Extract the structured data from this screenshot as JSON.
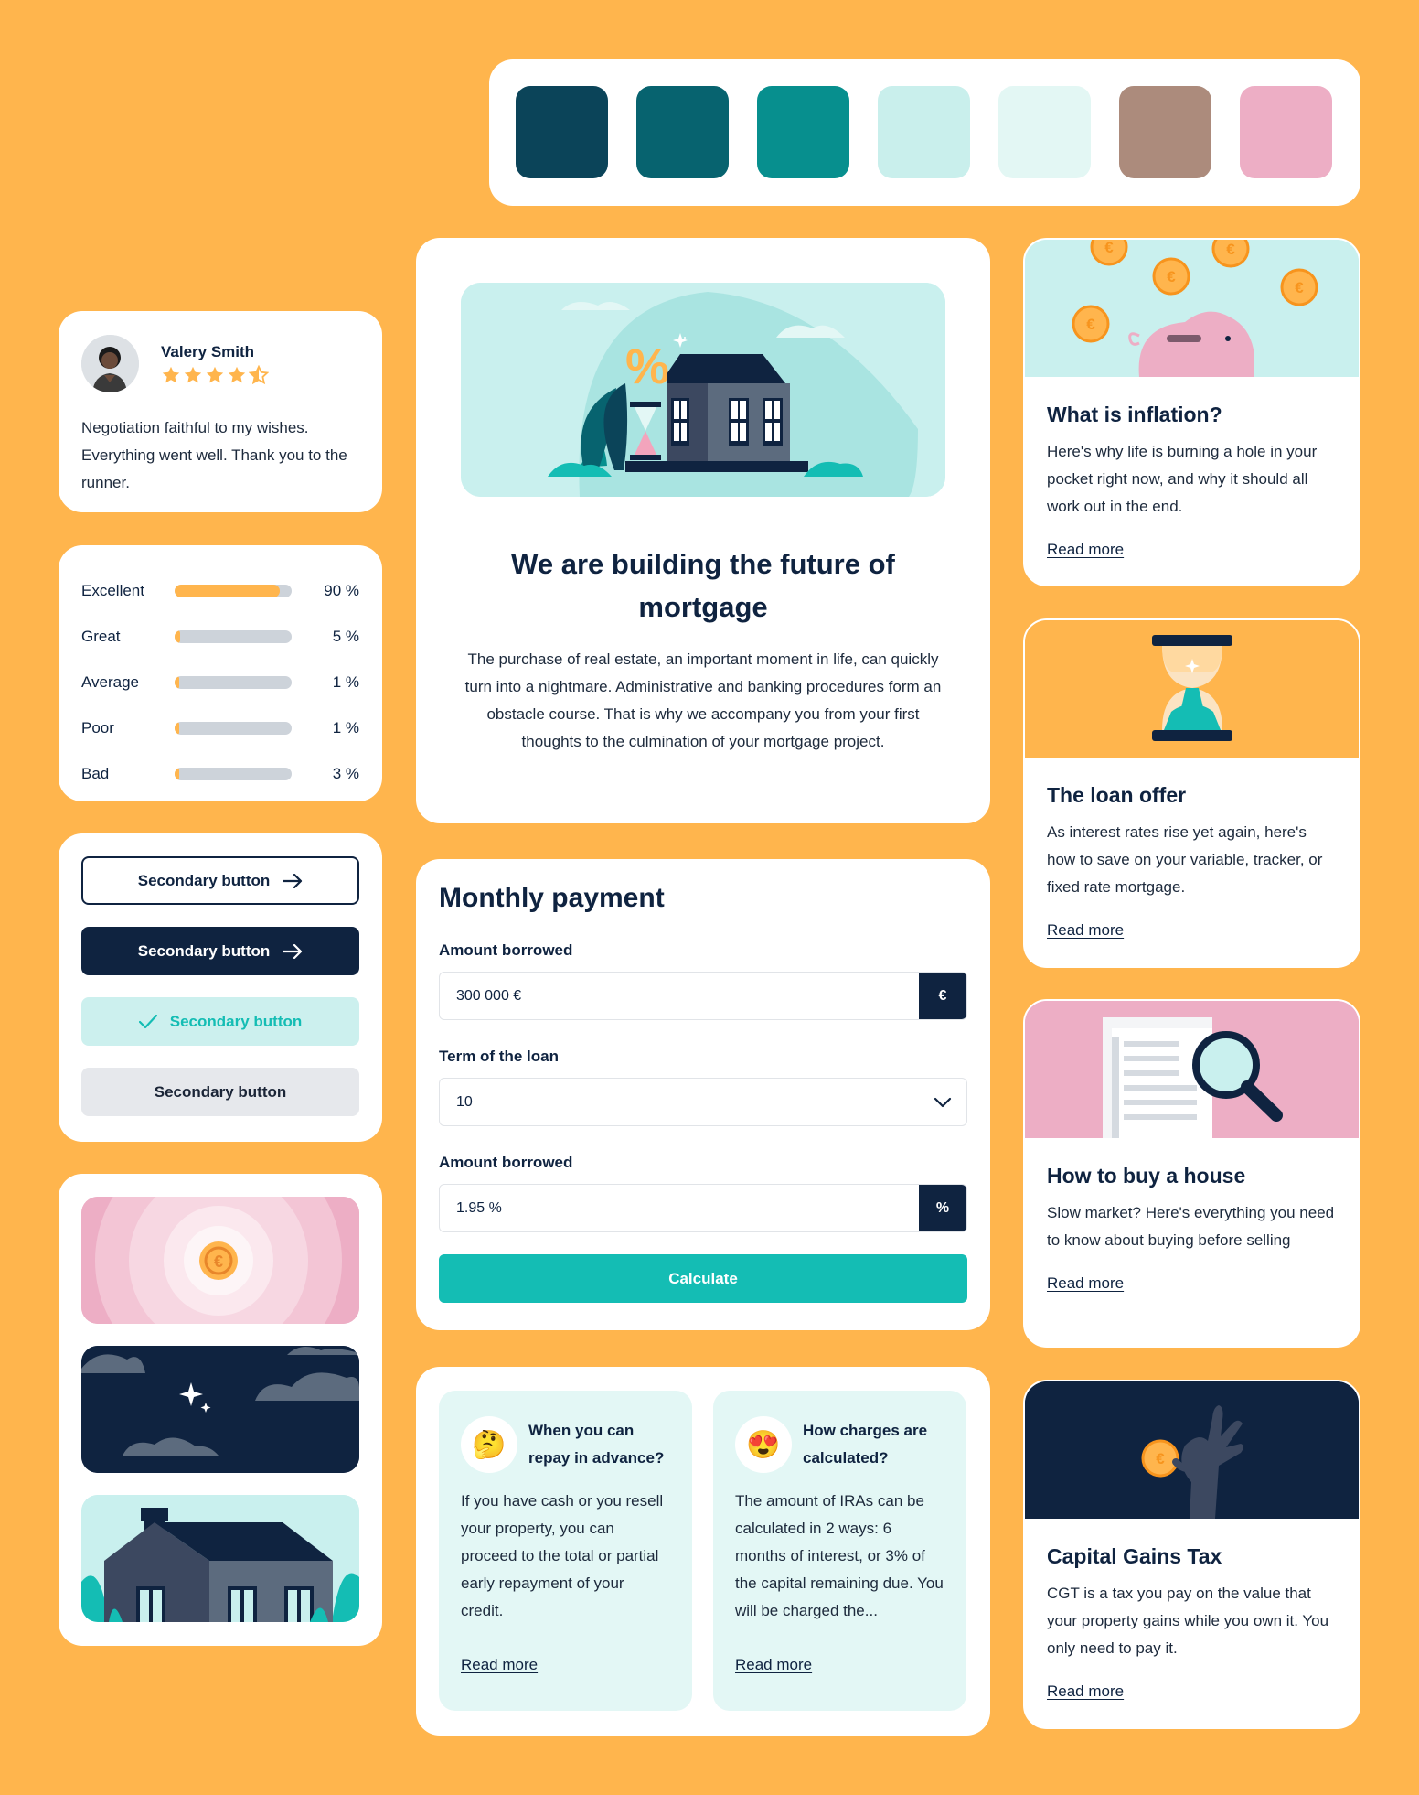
{
  "colors": {
    "palette": [
      "#0B4459",
      "#07636F",
      "#078F8E",
      "#C9EFEC",
      "#E3F7F4",
      "#AC8B7C",
      "#EDAEC5"
    ],
    "background": "#FFB54D",
    "navy": "#0F2340",
    "teal": "#14BDB4"
  },
  "review": {
    "name": "Valery Smith",
    "rating": 4.5,
    "text": "Negotiation faithful to my wishes. Everything went well. Thank you to the runner."
  },
  "ratings": [
    {
      "label": "Excellent",
      "value": 90,
      "pct": "90 %"
    },
    {
      "label": "Great",
      "value": 5,
      "pct": "5 %"
    },
    {
      "label": "Average",
      "value": 1,
      "pct": "1 %"
    },
    {
      "label": "Poor",
      "value": 1,
      "pct": "1 %"
    },
    {
      "label": "Bad",
      "value": 3,
      "pct": "3 %"
    }
  ],
  "buttons": {
    "outline": "Secondary button",
    "dark": "Secondary button",
    "success": "Secondary button",
    "disabled": "Secondary button"
  },
  "hero": {
    "title": "We are building the future of mortgage",
    "text": "The purchase of real estate, an important moment in life, can quickly turn into a nightmare. Administrative and banking procedures form an obstacle course. That is why we accompany you from your first thoughts to the culmination of your mortgage project."
  },
  "monthly": {
    "title": "Monthly payment",
    "amount_label": "Amount borrowed",
    "amount_value": "300 000 €",
    "amount_unit": "€",
    "term_label": "Term of the loan",
    "term_value": "10",
    "rate_label": "Amount borrowed",
    "rate_value": "1.95 %",
    "rate_unit": "%",
    "calculate": "Calculate"
  },
  "faq": [
    {
      "emoji": "🤔",
      "question": "When you can repay in advance?",
      "text": "If you have cash or you resell your property, you can proceed to the total or partial early repayment of your credit.",
      "link": "Read more"
    },
    {
      "emoji": "😍",
      "question": "How charges are calculated?",
      "text": "The amount of IRAs can be calculated in 2 ways: 6 months of interest, or 3% of the capital remaining due. You will be charged the...",
      "link": "Read more"
    }
  ],
  "articles": [
    {
      "title": "What is inflation?",
      "text": "Here's why life is burning a hole in your pocket right now, and why it should all work out in the end.",
      "link": "Read more"
    },
    {
      "title": "The loan offer",
      "text": "As interest rates rise yet again, here's how to save on your variable, tracker, or fixed rate mortgage.",
      "link": "Read more"
    },
    {
      "title": "How to buy a house",
      "text": "Slow market? Here's everything you need to know about buying before selling",
      "link": "Read more"
    },
    {
      "title": "Capital Gains Tax",
      "text": "CGT is a tax you pay on the value that your property gains while you own it. You only need to pay it.",
      "link": "Read more"
    }
  ]
}
